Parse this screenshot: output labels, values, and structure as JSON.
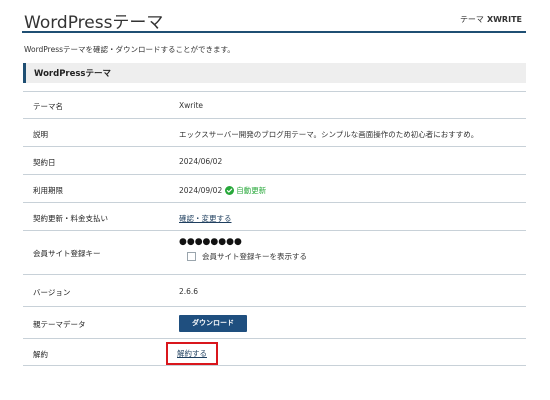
{
  "header": {
    "title": "WordPressテーマ",
    "right_prefix": "テーマ",
    "right_brand": "XWRITE"
  },
  "description": "WordPressテーマを確認・ダウンロードすることができます。",
  "section": {
    "title": "WordPressテーマ"
  },
  "rows": {
    "theme_name": {
      "label": "テーマ名",
      "value": "Xwrite"
    },
    "explanation": {
      "label": "説明",
      "value": "エックスサーバー開発のブログ用テーマ。シンプルな画面操作のため初心者におすすめ。"
    },
    "contract_date": {
      "label": "契約日",
      "value": "2024/06/02"
    },
    "expiry": {
      "label": "利用期限",
      "value": "2024/09/02",
      "auto_renew": "自動更新"
    },
    "renewal": {
      "label": "契約更新・料金支払い",
      "link": "確認・変更する"
    },
    "member_key": {
      "label": "会員サイト登録キー",
      "masked": "●●●●●●●●",
      "checkbox_label": "会員サイト登録キーを表示する"
    },
    "version": {
      "label": "バージョン",
      "value": "2.6.6"
    },
    "parent_theme": {
      "label": "親テーマデータ",
      "button": "ダウンロード"
    },
    "cancellation": {
      "label": "解約",
      "link": "解約する"
    }
  },
  "colors": {
    "accent": "#1f4f73",
    "button": "#1f4f7f",
    "success": "#27a83a",
    "highlight": "#d9161c"
  }
}
